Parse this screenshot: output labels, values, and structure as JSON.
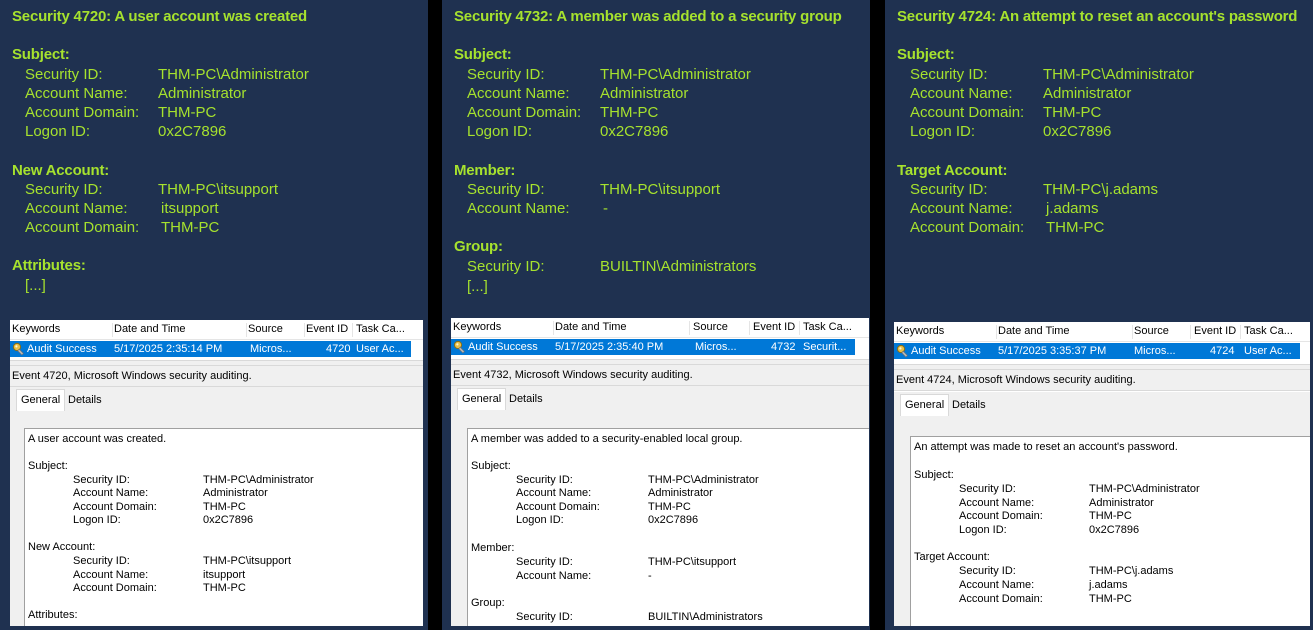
{
  "panels": [
    {
      "title": "Security 4720: A user account was created",
      "subject_label": "Subject:",
      "subject": [
        {
          "k": "Security ID:",
          "v": "THM-PC\\Administrator"
        },
        {
          "k": "Account Name:",
          "v": "Administrator"
        },
        {
          "k": "Account Domain:",
          "v": "THM-PC"
        },
        {
          "k": "Logon ID:",
          "v": "0x2C7896"
        }
      ],
      "section2_label": "New Account:",
      "section2": [
        {
          "k": "Security ID:",
          "v": "THM-PC\\itsupport"
        },
        {
          "k": "Account Name:",
          "v": "itsupport"
        },
        {
          "k": "Account Domain:",
          "v": "THM-PC"
        }
      ],
      "section3_label": "Attributes:",
      "section3_text": "[...]",
      "viewer": {
        "columns": [
          "Keywords",
          "Date and Time",
          "Source",
          "Event ID",
          "Task Ca..."
        ],
        "row": {
          "keyword": "Audit Success",
          "datetime": "5/17/2025 2:35:14 PM",
          "source": "Micros...",
          "event_id": "4720",
          "task": "User Ac..."
        },
        "event_header": "Event 4720, Microsoft Windows security auditing.",
        "tabs": [
          "General",
          "Details"
        ],
        "detail": {
          "intro": "A user account was created.",
          "subject_label": "Subject:",
          "subject": [
            {
              "k": "Security ID:",
              "v": "THM-PC\\Administrator"
            },
            {
              "k": "Account Name:",
              "v": "Administrator"
            },
            {
              "k": "Account Domain:",
              "v": "THM-PC"
            },
            {
              "k": "Logon ID:",
              "v": "0x2C7896"
            }
          ],
          "section2_label": "New Account:",
          "section2": [
            {
              "k": "Security ID:",
              "v": "THM-PC\\itsupport"
            },
            {
              "k": "Account Name:",
              "v": "itsupport"
            },
            {
              "k": "Account Domain:",
              "v": "THM-PC"
            }
          ],
          "section3_label": "Attributes:"
        }
      }
    },
    {
      "title": "Security 4732: A member was added to a security group",
      "subject_label": "Subject:",
      "subject": [
        {
          "k": "Security ID:",
          "v": "THM-PC\\Administrator"
        },
        {
          "k": "Account Name:",
          "v": "Administrator"
        },
        {
          "k": "Account Domain:",
          "v": "THM-PC"
        },
        {
          "k": "Logon ID:",
          "v": "0x2C7896"
        }
      ],
      "section2_label": "Member:",
      "section2": [
        {
          "k": "Security ID:",
          "v": "THM-PC\\itsupport"
        },
        {
          "k": "Account Name:",
          "v": "-"
        }
      ],
      "section3_label": "Group:",
      "section3": [
        {
          "k": "Security ID:",
          "v": "BUILTIN\\Administrators"
        }
      ],
      "section3_text": "[...]",
      "viewer": {
        "columns": [
          "Keywords",
          "Date and Time",
          "Source",
          "Event ID",
          "Task Ca..."
        ],
        "row": {
          "keyword": "Audit Success",
          "datetime": "5/17/2025 2:35:40 PM",
          "source": "Micros...",
          "event_id": "4732",
          "task": "Securit..."
        },
        "event_header": "Event 4732, Microsoft Windows security auditing.",
        "tabs": [
          "General",
          "Details"
        ],
        "detail": {
          "intro": "A member was added to a security-enabled local group.",
          "subject_label": "Subject:",
          "subject": [
            {
              "k": "Security ID:",
              "v": "THM-PC\\Administrator"
            },
            {
              "k": "Account Name:",
              "v": "Administrator"
            },
            {
              "k": "Account Domain:",
              "v": "THM-PC"
            },
            {
              "k": "Logon ID:",
              "v": "0x2C7896"
            }
          ],
          "section2_label": "Member:",
          "section2": [
            {
              "k": "Security ID:",
              "v": "THM-PC\\itsupport"
            },
            {
              "k": "Account Name:",
              "v": "-"
            }
          ],
          "section3_label": "Group:",
          "section3": [
            {
              "k": "Security ID:",
              "v": "BUILTIN\\Administrators"
            }
          ]
        }
      }
    },
    {
      "title": "Security 4724: An attempt to reset an account's password",
      "subject_label": "Subject:",
      "subject": [
        {
          "k": "Security ID:",
          "v": "THM-PC\\Administrator"
        },
        {
          "k": "Account Name:",
          "v": "Administrator"
        },
        {
          "k": "Account Domain:",
          "v": "THM-PC"
        },
        {
          "k": "Logon ID:",
          "v": "0x2C7896"
        }
      ],
      "section2_label": "Target Account:",
      "section2": [
        {
          "k": "Security ID:",
          "v": "THM-PC\\j.adams"
        },
        {
          "k": "Account Name:",
          "v": "j.adams"
        },
        {
          "k": "Account Domain:",
          "v": "THM-PC"
        }
      ],
      "viewer": {
        "columns": [
          "Keywords",
          "Date and Time",
          "Source",
          "Event ID",
          "Task Ca..."
        ],
        "row": {
          "keyword": "Audit Success",
          "datetime": "5/17/2025 3:35:37 PM",
          "source": "Micros...",
          "event_id": "4724",
          "task": "User Ac..."
        },
        "event_header": "Event 4724, Microsoft Windows security auditing.",
        "tabs": [
          "General",
          "Details"
        ],
        "detail": {
          "intro": "An attempt was made to reset an account's password.",
          "subject_label": "Subject:",
          "subject": [
            {
              "k": "Security ID:",
              "v": "THM-PC\\Administrator"
            },
            {
              "k": "Account Name:",
              "v": "Administrator"
            },
            {
              "k": "Account Domain:",
              "v": "THM-PC"
            },
            {
              "k": "Logon ID:",
              "v": "0x2C7896"
            }
          ],
          "section2_label": "Target Account:",
          "section2": [
            {
              "k": "Security ID:",
              "v": "THM-PC\\j.adams"
            },
            {
              "k": "Account Name:",
              "v": "j.adams"
            },
            {
              "k": "Account Domain:",
              "v": "THM-PC"
            }
          ]
        }
      }
    }
  ]
}
